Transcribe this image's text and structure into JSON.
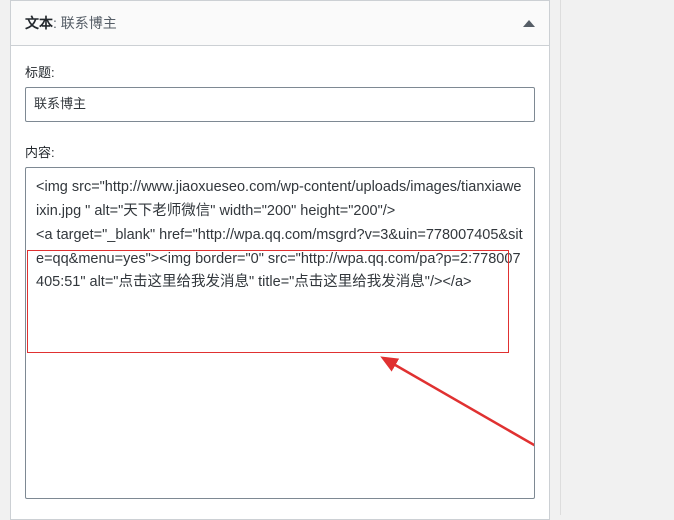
{
  "widget": {
    "header_prefix": "文本",
    "header_separator": ": ",
    "header_name": "联系博主"
  },
  "fields": {
    "title_label": "标题:",
    "title_value": "联系博主",
    "content_label": "内容:",
    "content_value": "<img src=\"http://www.jiaoxueseo.com/wp-content/uploads/images/tianxiaweixin.jpg \" alt=\"天下老师微信\" width=\"200\" height=\"200\"/>\n<a target=\"_blank\" href=\"http://wpa.qq.com/msgrd?v=3&uin=778007405&site=qq&menu=yes\"><img border=\"0\" src=\"http://wpa.qq.com/pa?p=2:778007405:51\" alt=\"点击这里给我发消息\" title=\"点击这里给我发消息\"/></a>"
  },
  "annotation": {
    "highlight_color": "#e03131",
    "arrow_color": "#e03131"
  }
}
